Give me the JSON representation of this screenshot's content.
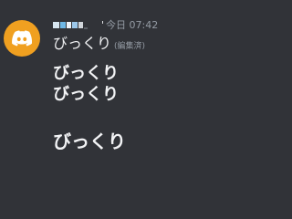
{
  "message": {
    "avatar_icon": "discord-logo-icon",
    "avatar_color": "#f0a020",
    "username_obscured": true,
    "username_suffix": "'",
    "timestamp": "今日 07:42",
    "lines": [
      {
        "text": "びっくり",
        "edited_label": "(編集済)"
      },
      {
        "text": "びっくり"
      },
      {
        "text": "びっくり"
      },
      {
        "text": "びっくり"
      }
    ]
  }
}
